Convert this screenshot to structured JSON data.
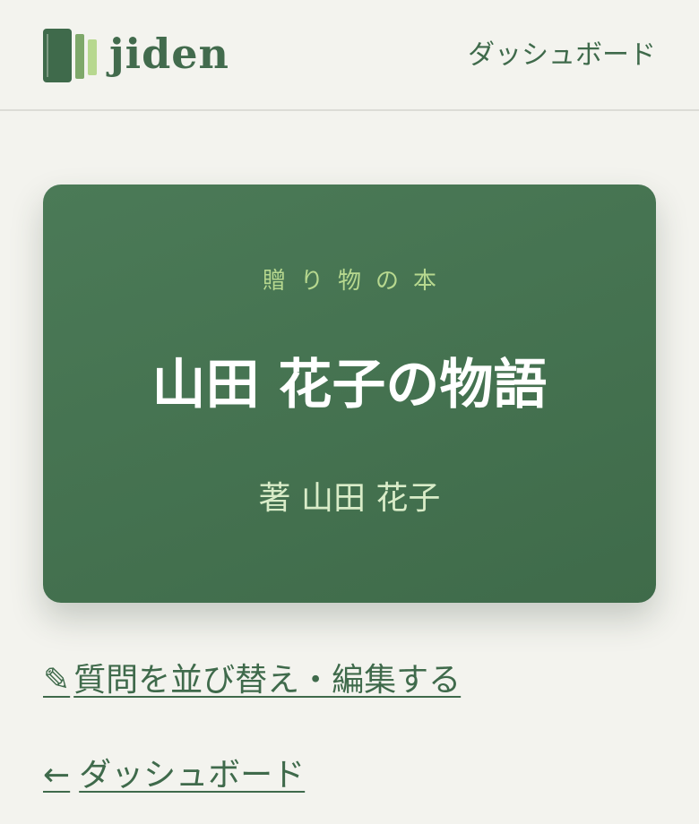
{
  "header": {
    "brand_name": "jiden",
    "nav_dashboard": "ダッシュボード",
    "logo_icon": "books-icon",
    "colors": {
      "logo_dark": "#3f6a4b",
      "logo_mid": "#7ea86a",
      "logo_light": "#b7d88f"
    }
  },
  "book_card": {
    "kicker": "贈り物の本",
    "title": "山田 花子の物語",
    "author_line": "著 山田 花子",
    "colors": {
      "background": "#46734f",
      "kicker": "#b7d88f",
      "title": "#ffffff",
      "author": "#d9ecc8"
    }
  },
  "actions": {
    "edit_icon": "✎",
    "edit_label": "質問を並び替え・編集する",
    "back_arrow": "←",
    "back_label": "ダッシュボード"
  }
}
